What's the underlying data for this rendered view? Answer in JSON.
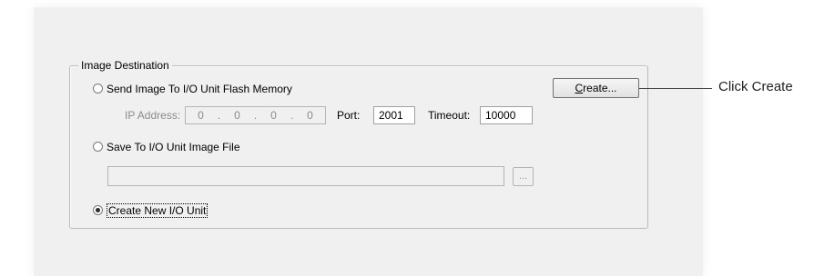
{
  "group": {
    "legend": "Image Destination"
  },
  "options": {
    "flash": {
      "label": "Send Image To I/O Unit Flash Memory",
      "selected": false,
      "ip_label": "IP Address:",
      "ip_segments": [
        "0",
        "0",
        "0",
        "0"
      ],
      "port_label": "Port:",
      "port_value": "2001",
      "timeout_label": "Timeout:",
      "timeout_value": "10000"
    },
    "file": {
      "label": "Save To I/O Unit Image File",
      "selected": false,
      "path_value": "",
      "browse_label": "..."
    },
    "create": {
      "label": "Create New I/O Unit",
      "selected": true
    }
  },
  "buttons": {
    "create_prefix": "C",
    "create_rest": "reate..."
  },
  "callout": {
    "text": "Click Create"
  }
}
